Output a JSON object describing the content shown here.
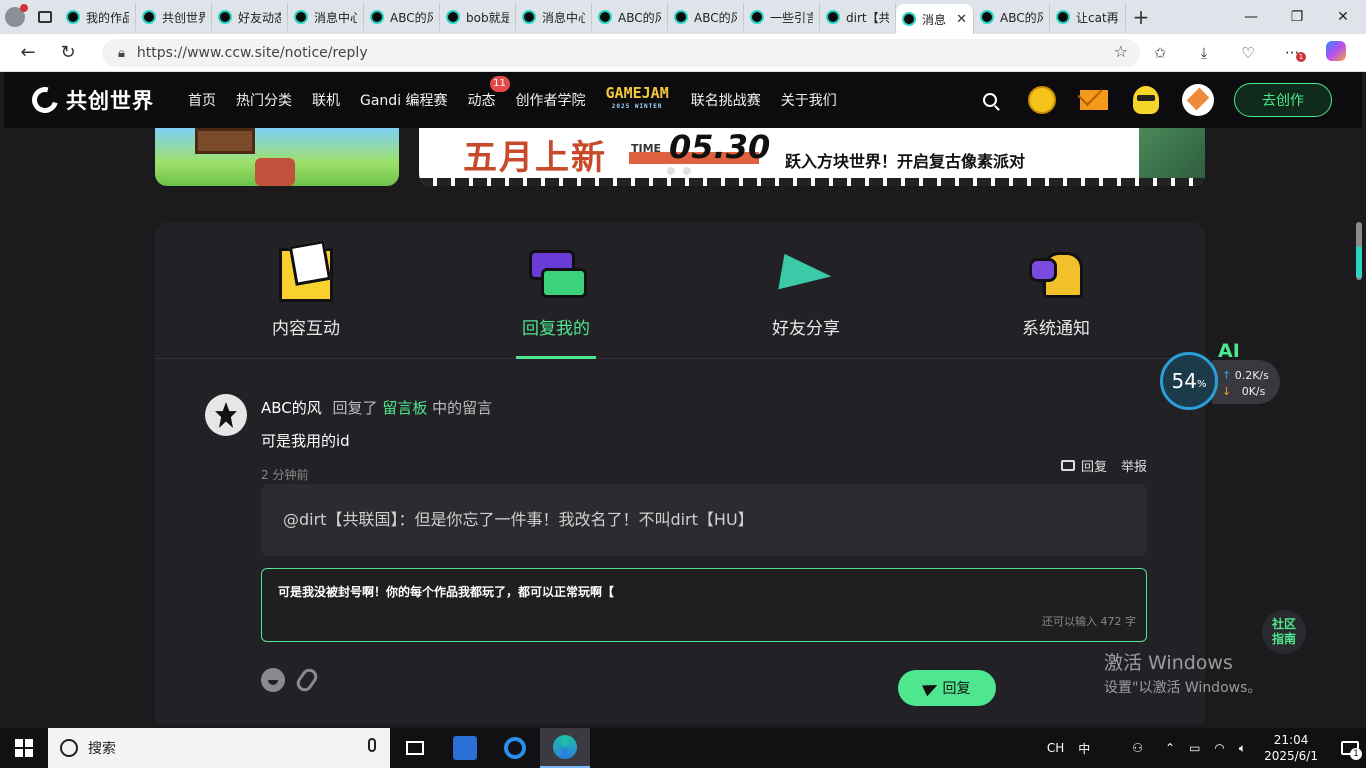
{
  "browser": {
    "tabs": [
      {
        "title": "我的作品"
      },
      {
        "title": "共创世界"
      },
      {
        "title": "好友动态"
      },
      {
        "title": "消息中心"
      },
      {
        "title": "ABC的风"
      },
      {
        "title": "bob就是"
      },
      {
        "title": "消息中心"
      },
      {
        "title": "ABC的风"
      },
      {
        "title": "ABC的风"
      },
      {
        "title": "一些引言"
      },
      {
        "title": "dirt【共"
      },
      {
        "title": "消息",
        "active": true
      },
      {
        "title": "ABC的风"
      },
      {
        "title": "让cat再"
      }
    ],
    "new_tab": "+",
    "url": "https://www.ccw.site/notice/reply",
    "badge_count": "1"
  },
  "site": {
    "logo_text": "共创世界",
    "nav": [
      "首页",
      "热门分类",
      "联机",
      "Gandi 编程赛",
      "动态",
      "创作者学院"
    ],
    "dynamic_badge": "11",
    "gamejam": {
      "main": "GAMEJAM",
      "sub": "2025 WINTER"
    },
    "nav_after": [
      "联名挑战赛",
      "关于我们"
    ],
    "create_button": "去创作"
  },
  "banner": {
    "title": "五月上新",
    "time_label": "TIME",
    "date": "05.30",
    "subtitle": "跃入方块世界！开启复古像素派对"
  },
  "notice_tabs": [
    {
      "label": "内容互动",
      "icon": "letter-icon"
    },
    {
      "label": "回复我的",
      "icon": "chat-bubbles-icon",
      "active": true
    },
    {
      "label": "好友分享",
      "icon": "paper-plane-icon"
    },
    {
      "label": "系统通知",
      "icon": "bell-icon"
    }
  ],
  "reply": {
    "user": "ABC的风",
    "action": "回复了",
    "board": "留言板",
    "suffix": "中的留言",
    "text": "可是我用的id",
    "time": "2 分钟前",
    "reply_label": "回复",
    "report_label": "举报",
    "quote": "@dirt【共联国】：但是你忘了一件事！我改名了！不叫dirt【HU】",
    "input_value": "可是我没被封号啊！你的每个作品我都玩了，都可以正常玩啊【",
    "remaining": "还可以输入 472 字",
    "submit": "回复"
  },
  "widget": {
    "ai": "AI",
    "percent": "54",
    "percent_sign": "%",
    "up": "0.2",
    "down": "0",
    "unit": "K/s"
  },
  "guide": {
    "line1": "社区",
    "line2": "指南"
  },
  "activate": {
    "line1": "激活 Windows",
    "line2": "设置\"以激活 Windows。"
  },
  "taskbar": {
    "search": "搜索",
    "ime_lang": "CH",
    "ime_mode": "中",
    "time": "21:04",
    "date": "2025/6/1",
    "notif_count": "1"
  }
}
